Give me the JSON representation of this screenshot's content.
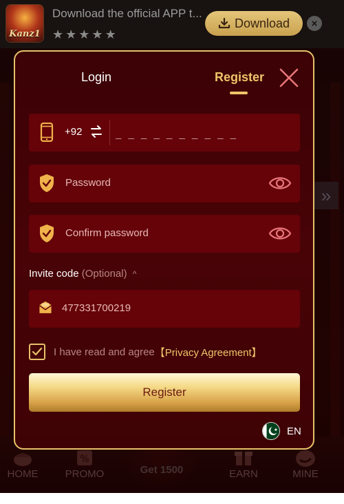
{
  "banner": {
    "app_name": "Kanz1",
    "title": "Download the official APP t...",
    "rating_stars": 5,
    "download_label": "Download",
    "close_symbol": "×"
  },
  "bottom_nav": {
    "items": [
      {
        "label": "HOME",
        "icon": "home-icon"
      },
      {
        "label": "PROMO",
        "icon": "promo-icon"
      },
      {
        "label": "Get 1500",
        "icon": "none"
      },
      {
        "label": "EARN",
        "icon": "gift-icon"
      },
      {
        "label": "MINE",
        "icon": "profile-icon"
      }
    ]
  },
  "modal": {
    "tabs": {
      "login": "Login",
      "register": "Register",
      "active": "register"
    },
    "phone": {
      "country_code": "+92",
      "placeholder": "_ _ _ _ _ _ _ _ _ _"
    },
    "password": {
      "placeholder": "Password"
    },
    "confirm_password": {
      "placeholder": "Confirm password"
    },
    "invite": {
      "label": "Invite code",
      "optional": "(Optional)",
      "value": "477331700219"
    },
    "agreement": {
      "text": "I have read and agree",
      "link": "【Privacy Agreement】",
      "checked": true
    },
    "register_button": "Register",
    "language": {
      "code": "EN",
      "flag": "pakistan-flag"
    }
  },
  "colors": {
    "accent_gold": "#f0c46a",
    "field_bg": "#650309",
    "modal_bg": "#480307"
  }
}
